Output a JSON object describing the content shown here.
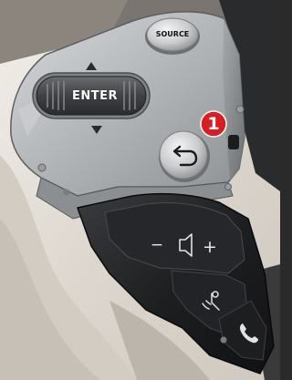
{
  "controls": {
    "source_label": "SOURCE",
    "enter_label": "ENTER",
    "volume_minus": "−",
    "volume_plus": "+"
  },
  "callout": {
    "number": "1",
    "color": "#d81e22"
  },
  "icons": {
    "up": "triangle-up-icon",
    "down": "triangle-down-icon",
    "back": "back-arrow-icon",
    "speaker": "speaker-icon",
    "voice": "voice-command-icon",
    "phone": "phone-icon"
  },
  "colors": {
    "silver": "#b9bcbf",
    "black_panel": "#1b1c1e",
    "seat": "#e9e4dd"
  }
}
